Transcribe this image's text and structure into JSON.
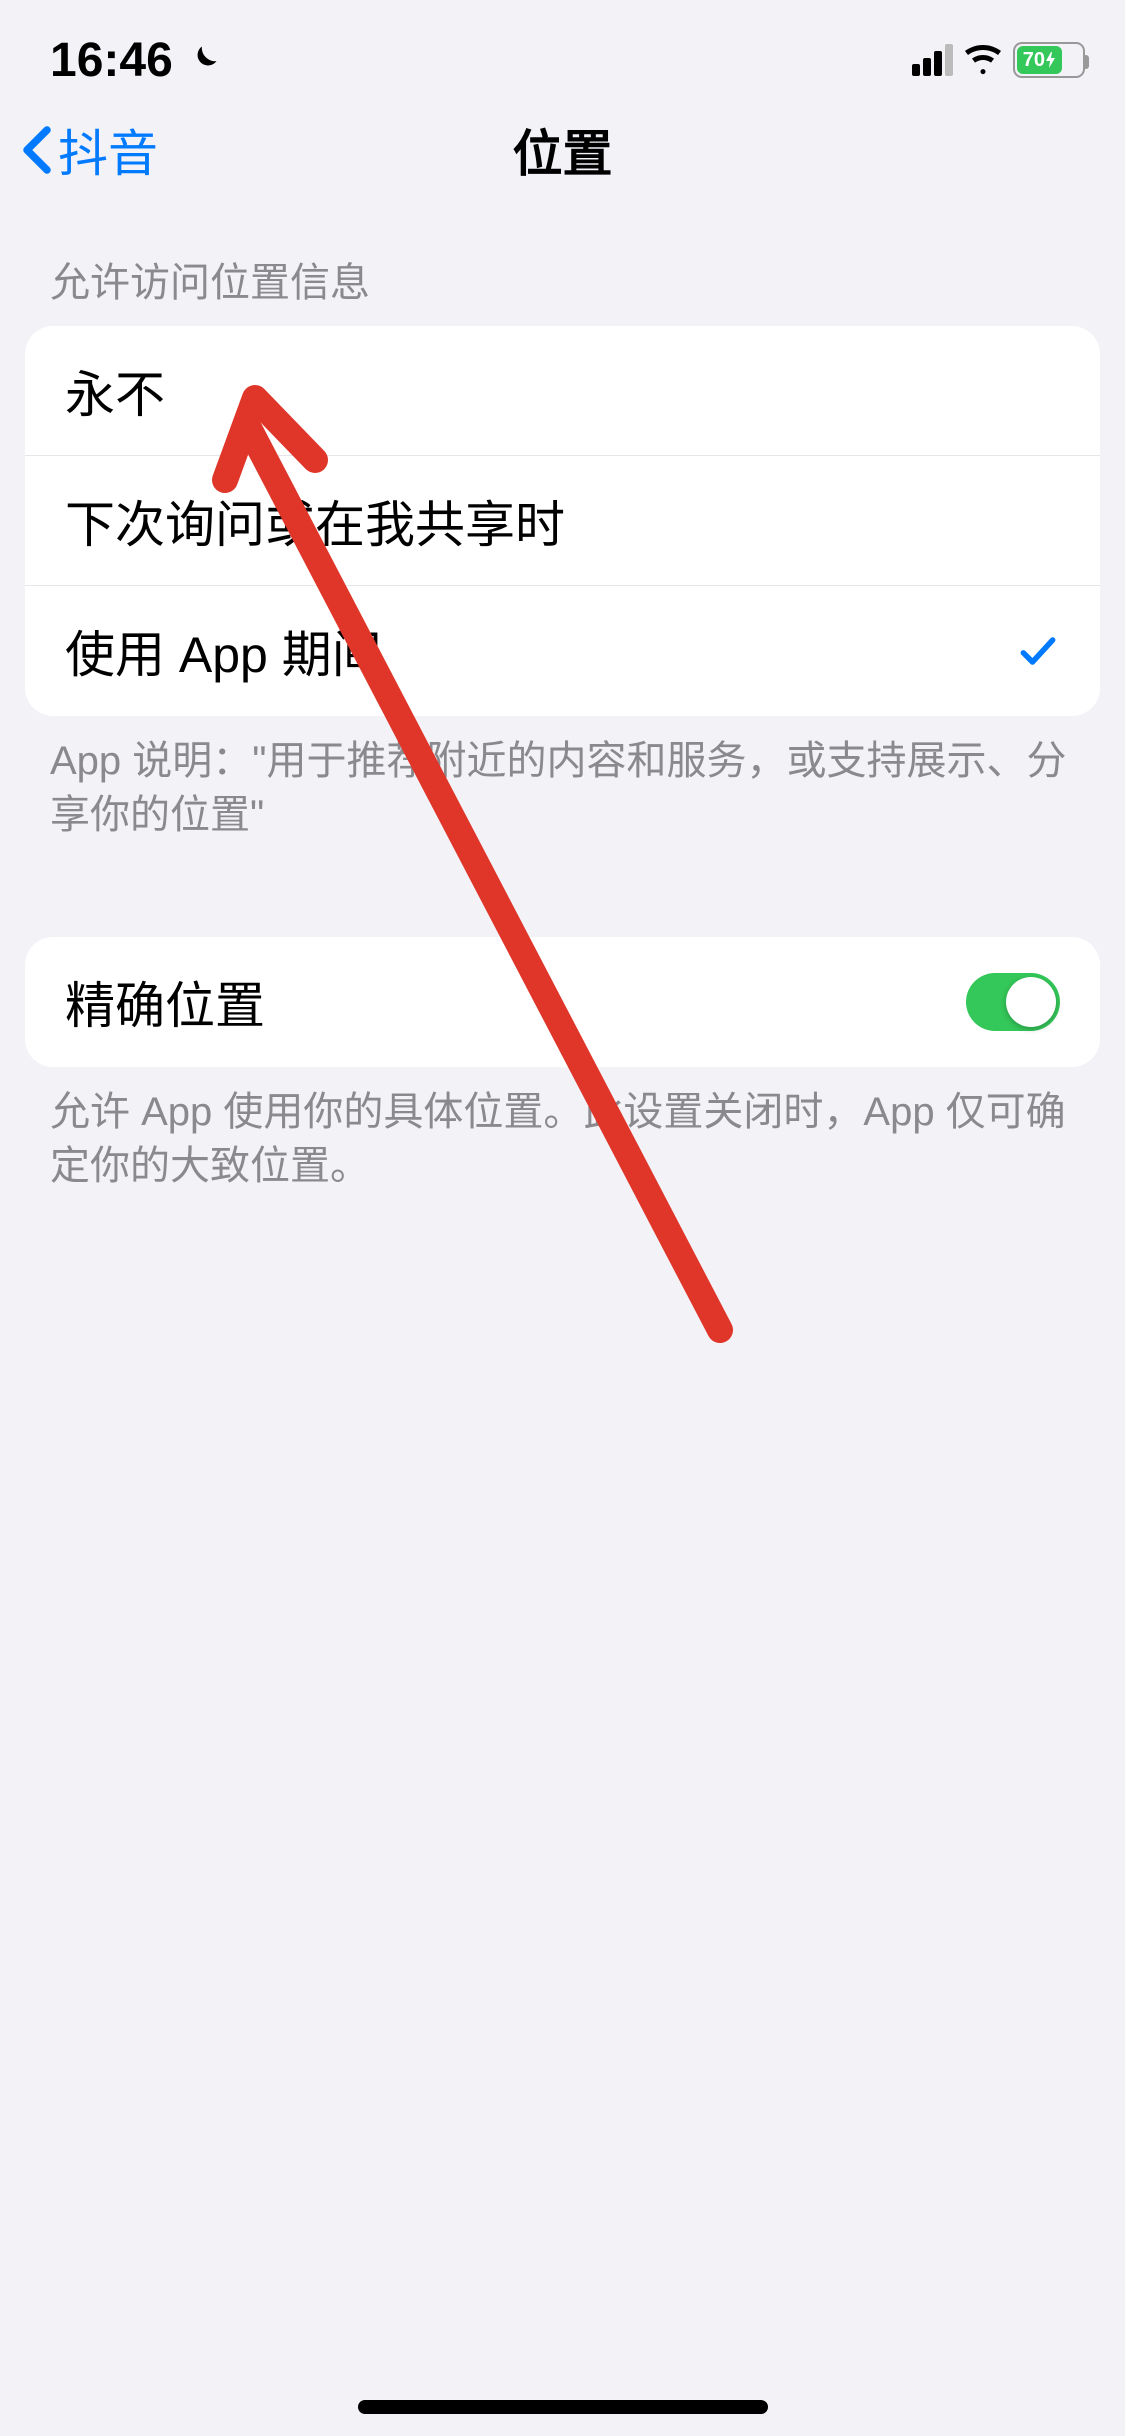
{
  "status": {
    "time": "16:46",
    "battery_pct": "70"
  },
  "nav": {
    "back_label": "抖音",
    "title": "位置"
  },
  "sections": {
    "location_access": {
      "header": "允许访问位置信息",
      "options": [
        {
          "label": "永不",
          "selected": false
        },
        {
          "label": "下次询问或在我共享时",
          "selected": false
        },
        {
          "label": "使用 App 期间",
          "selected": true
        }
      ],
      "footer": "App 说明：\"用于推荐附近的内容和服务，或支持展示、分享你的位置\""
    },
    "precise": {
      "label": "精确位置",
      "enabled": true,
      "footer": "允许 App 使用你的具体位置。此设置关闭时，App 仅可确定你的大致位置。"
    }
  },
  "colors": {
    "accent": "#007aff",
    "toggle_on": "#34c759",
    "annotation": "#e0362a"
  }
}
